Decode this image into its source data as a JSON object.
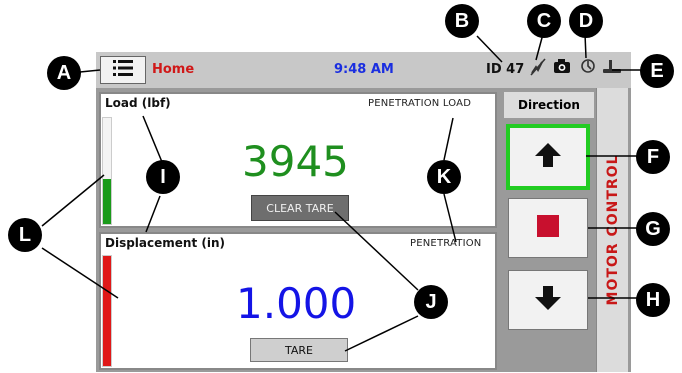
{
  "topbar": {
    "home_label": "Home",
    "time": "9:48 AM",
    "id_text": "ID 47"
  },
  "load_panel": {
    "title": "Load (lbf)",
    "subtitle": "PENETRATION LOAD",
    "value": "3945",
    "value_color": "#1f8f1f",
    "button_label": "CLEAR TARE"
  },
  "displacement_panel": {
    "title": "Displacement (in)",
    "subtitle": "PENETRATION",
    "value": "1.000",
    "value_color": "#1414e6",
    "button_label": "TARE"
  },
  "motor": {
    "direction_label": "Direction",
    "control_label": "MOTOR CONTROL"
  },
  "callouts": [
    "A",
    "B",
    "C",
    "D",
    "E",
    "F",
    "G",
    "H",
    "I",
    "J",
    "K",
    "L"
  ],
  "colors": {
    "accent_red": "#d01818",
    "time_blue": "#1a2ee0",
    "active_green": "#22cc22"
  },
  "icons": [
    "menu-icon",
    "wifi-off-icon",
    "camera-icon",
    "network-icon",
    "usb-icon",
    "up-arrow-icon",
    "stop-icon",
    "down-arrow-icon"
  ]
}
